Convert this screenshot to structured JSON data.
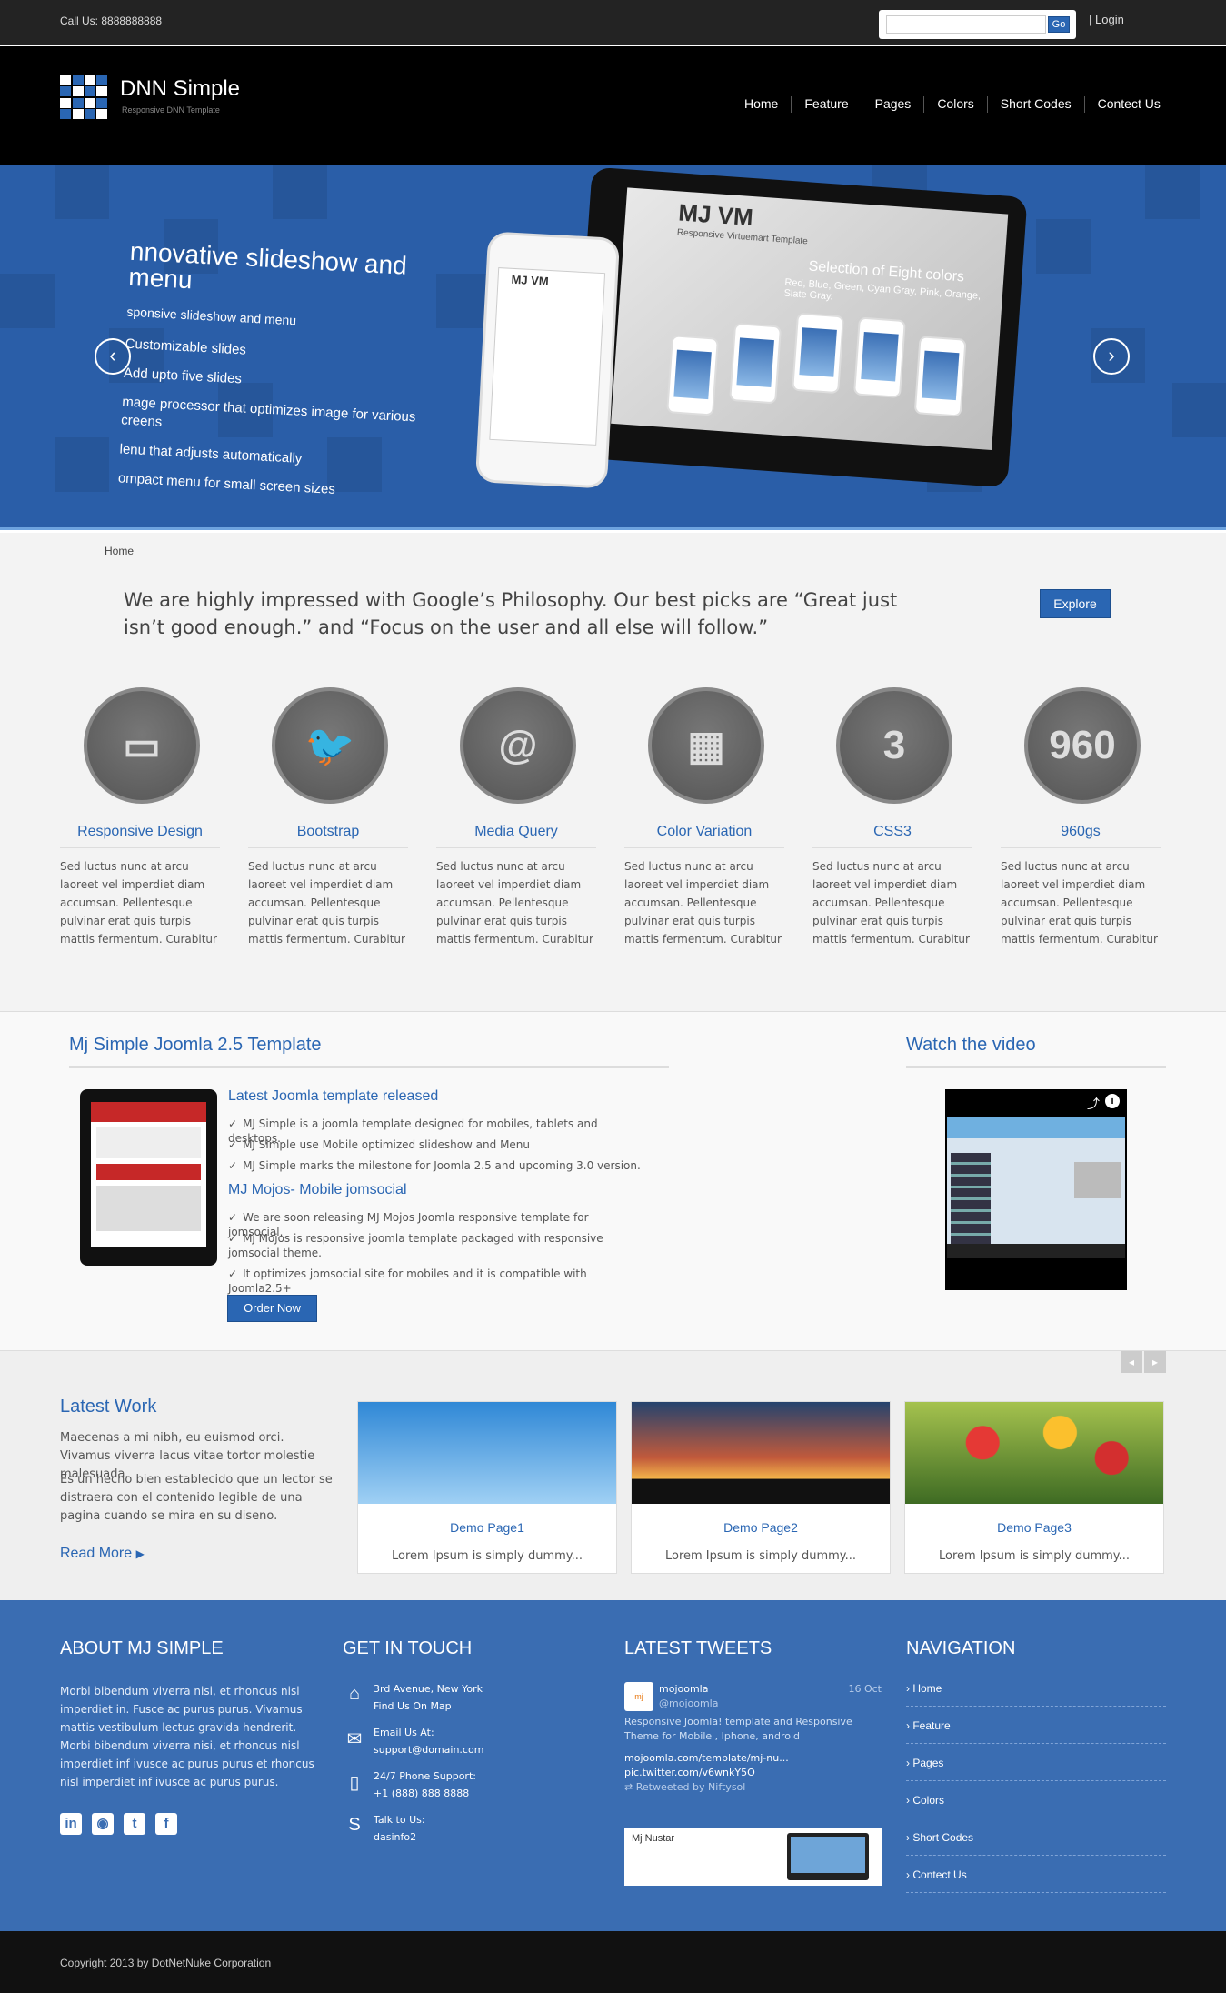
{
  "topbar": {
    "call": "Call Us: 8888888888",
    "search_placeholder": "",
    "go": "Go",
    "login": "Login"
  },
  "header": {
    "logo_title": "DNN Simple",
    "logo_sub": "Responsive DNN Template",
    "nav": [
      "Home",
      "Feature",
      "Pages",
      "Colors",
      "Short Codes",
      "Contect Us"
    ]
  },
  "slider": {
    "title": "nnovative slideshow and menu",
    "subtitle": "sponsive slideshow and menu",
    "items": [
      "Customizable slides",
      "Add upto five slides",
      "mage processor that optimizes image for various creens",
      "lenu that adjusts automatically",
      "ompact menu for small screen sizes"
    ],
    "prev": "‹",
    "next": "›",
    "tablet_title": "MJ VM",
    "tablet_sub": "Responsive Virtuemart Template",
    "tablet_heading": "Selection of Eight colors",
    "tablet_colors": "Red, Blue, Green, Cyan Gray, Pink, Orange, Slate Gray.",
    "phone_title": "MJ VM"
  },
  "breadcrumb": "Home",
  "quote": "We are highly impressed with Google’s Philosophy. Our best picks are “Great just isn’t good enough.” and “Focus on the user and all else will follow.”",
  "explore": "Explore",
  "features": [
    {
      "title": "Responsive Design",
      "icon": "devices-icon",
      "glyph": "▭",
      "body": "Sed luctus nunc at arcu laoreet vel imperdiet diam accumsan. Pellentesque pulvinar erat quis turpis mattis fermentum. Curabitur"
    },
    {
      "title": "Bootstrap",
      "icon": "twitter-bird-icon",
      "glyph": "🐦",
      "body": "Sed luctus nunc at arcu laoreet vel imperdiet diam accumsan. Pellentesque pulvinar erat quis turpis mattis fermentum. Curabitur"
    },
    {
      "title": "Media Query",
      "icon": "at-sign-icon",
      "glyph": "@",
      "body": "Sed luctus nunc at arcu laoreet vel imperdiet diam accumsan. Pellentesque pulvinar erat quis turpis mattis fermentum. Curabitur"
    },
    {
      "title": "Color Variation",
      "icon": "checker-flag-icon",
      "glyph": "▦",
      "body": "Sed luctus nunc at arcu laoreet vel imperdiet diam accumsan. Pellentesque pulvinar erat quis turpis mattis fermentum. Curabitur"
    },
    {
      "title": "CSS3",
      "icon": "css3-shield-icon",
      "glyph": "3",
      "body": "Sed luctus nunc at arcu laoreet vel imperdiet diam accumsan. Pellentesque pulvinar erat quis turpis mattis fermentum. Curabitur"
    },
    {
      "title": "960gs",
      "icon": "960-grid-icon",
      "glyph": "960",
      "body": "Sed luctus nunc at arcu laoreet vel imperdiet diam accumsan. Pellentesque pulvinar erat quis turpis mattis fermentum. Curabitur"
    }
  ],
  "template": {
    "title": "Mj Simple Joomla 2.5 Template",
    "h1": "Latest Joomla template released",
    "list1": [
      "MJ Simple is a joomla template designed for mobiles, tablets and desktops.",
      "MJ Simple use Mobile optimized slideshow and Menu",
      "MJ Simple marks the milestone for Joomla 2.5 and upcoming 3.0 version."
    ],
    "h2": "MJ Mojos- Mobile jomsocial",
    "list2": [
      "We are soon releasing MJ Mojos Joomla responsive template for jomsocial.",
      "Mj Mojos is responsive joomla template packaged with responsive jomsocial theme.",
      "It optimizes jomsocial site for mobiles and it is compatible with Joomla2.5+"
    ],
    "order": "Order Now",
    "video_title": "Watch the video"
  },
  "work": {
    "title": "Latest Work",
    "p1": "Maecenas a mi nibh, eu euismod orci. Vivamus viverra lacus vitae tortor molestie malesuada.",
    "p2": "Es un hecho bien establecido que un lector se distraera con el contenido legible de una pagina cuando se mira en su diseno.",
    "readmore": "Read More",
    "cards": [
      {
        "title": "Demo Page1",
        "desc": "Lorem Ipsum is simply dummy..."
      },
      {
        "title": "Demo Page2",
        "desc": "Lorem Ipsum is simply dummy..."
      },
      {
        "title": "Demo Page3",
        "desc": "Lorem Ipsum is simply dummy..."
      }
    ]
  },
  "footer": {
    "about_title": "ABOUT MJ SIMPLE",
    "about_text": "Morbi bibendum viverra nisi, et rhoncus nisl imperdiet in. Fusce ac purus purus. Vivamus mattis vestibulum lectus gravida hendrerit. Morbi bibendum viverra nisi, et rhoncus nisl imperdiet inf ivusce ac purus purus et rhoncus nisl imperdiet inf ivusce ac purus purus.",
    "touch_title": "GET IN TOUCH",
    "address1": "3rd Avenue, New York",
    "address2": "Find Us On Map",
    "email_label": "Email Us At:",
    "email": "support@domain.com",
    "phone_label": "24/7 Phone Support:",
    "phone": "+1 (888) 888 8888",
    "talk_label": "Talk to Us:",
    "skype": "dasinfo2",
    "tweets_title": "LATEST TWEETS",
    "tweet_user": "mojoomla",
    "tweet_handle": "@mojoomla",
    "tweet_date": "16 Oct",
    "tweet_text": "Responsive Joomla! template and Responsive Theme for Mobile , Iphone, android",
    "tweet_link1": "mojoomla.com/template/mj-nu...",
    "tweet_link2": "pic.twitter.com/v6wnkY5O",
    "retweet": "Retweeted by Niftysol",
    "tweet_img_title": "Mj Nustar",
    "nav_title": "NAVIGATION",
    "nav": [
      "Home",
      "Feature",
      "Pages",
      "Colors",
      "Short Codes",
      "Contect Us"
    ],
    "copyright": "Copyright 2013 by DotNetNuke Corporation"
  },
  "colors": {
    "accent": "#2a66b3",
    "footer_bg": "#3a6db2",
    "slider_bg": "#2a5ea8"
  }
}
